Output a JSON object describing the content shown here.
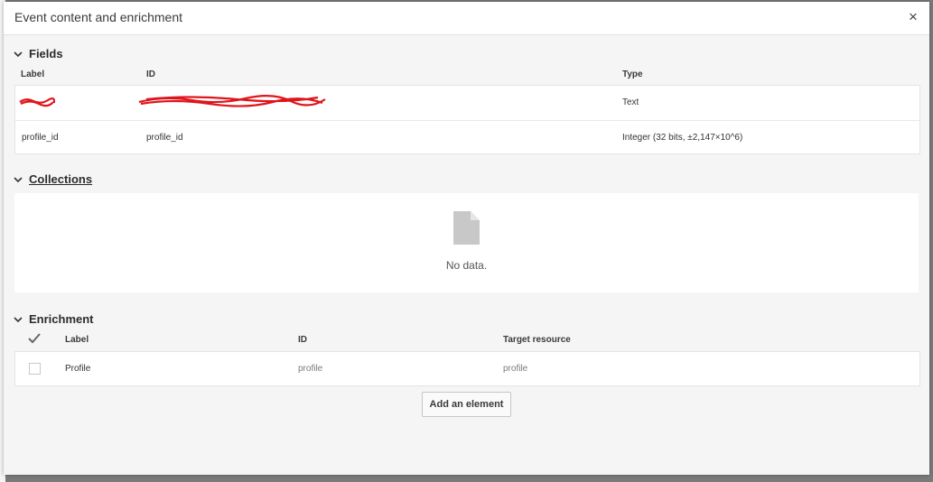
{
  "dialog": {
    "title": "Event content and enrichment",
    "close_label": "×"
  },
  "fields": {
    "title": "Fields",
    "columns": {
      "label": "Label",
      "id": "ID",
      "type": "Type"
    },
    "rows": [
      {
        "label": "",
        "id": "",
        "type": "Text"
      },
      {
        "label": "profile_id",
        "id": "profile_id",
        "type": "Integer (32 bits, ±2,147×10^6)"
      }
    ]
  },
  "collections": {
    "title": "Collections",
    "empty_text": "No data."
  },
  "enrichment": {
    "title": "Enrichment",
    "columns": {
      "label": "Label",
      "id": "ID",
      "target": "Target resource"
    },
    "rows": [
      {
        "label": "Profile",
        "id": "profile",
        "target": "profile",
        "checked": false
      }
    ],
    "add_button": "Add an element"
  },
  "colors": {
    "redaction": "#e0151b",
    "icon_gray": "#c8c8c8"
  }
}
